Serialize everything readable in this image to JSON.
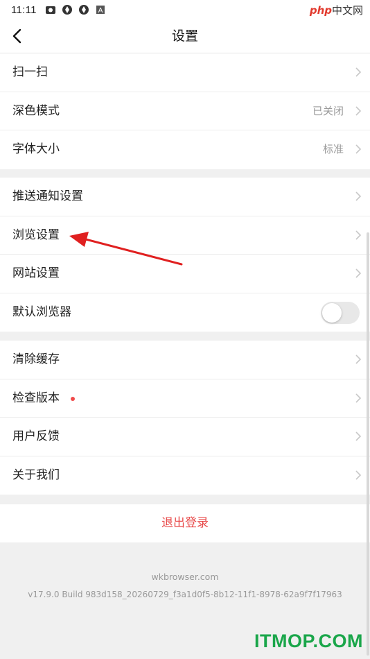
{
  "status_bar": {
    "time": "11:11",
    "right_brand": "php",
    "right_text": "中文网",
    "icons": [
      "camera-icon",
      "sync-icon",
      "sync-icon",
      "a-icon"
    ]
  },
  "nav": {
    "title": "设置",
    "back_icon": "chevron-left-icon"
  },
  "group1": [
    {
      "label": "扫一扫",
      "value": ""
    },
    {
      "label": "深色模式",
      "value": "已关闭"
    },
    {
      "label": "字体大小",
      "value": "标准"
    }
  ],
  "group2": [
    {
      "label": "推送通知设置"
    },
    {
      "label": "浏览设置"
    },
    {
      "label": "网站设置"
    },
    {
      "label": "默认浏览器",
      "toggle": false
    }
  ],
  "group3": [
    {
      "label": "清除缓存"
    },
    {
      "label": "检查版本",
      "badge": "red-dot"
    },
    {
      "label": "用户反馈"
    },
    {
      "label": "关于我们"
    }
  ],
  "logout_label": "退出登录",
  "footer": {
    "site": "wkbrowser.com",
    "version": "v17.9.0 Build 983d158_20260729_f3a1d0f5-8b12-11f1-8978-62a9f7f17963"
  },
  "watermark": "ITMOP.COM",
  "colors": {
    "accent_red": "#e84a4a",
    "annotation_arrow": "#e02020",
    "watermark": "#1aa64a"
  }
}
